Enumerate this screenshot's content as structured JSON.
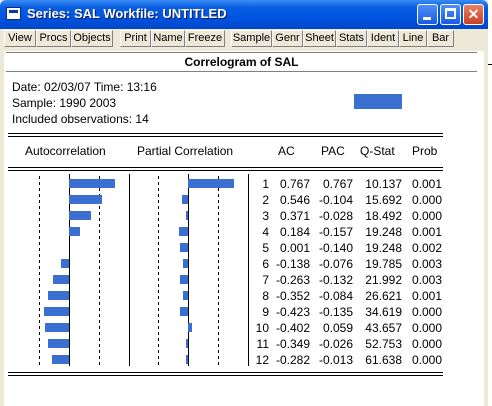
{
  "window": {
    "title": "Series: SAL    Workfile: UNTITLED",
    "controls": [
      "minimize-icon",
      "maximize-icon",
      "close-icon"
    ]
  },
  "toolbar": [
    "View",
    "Procs",
    "Objects",
    "Print",
    "Name",
    "Freeze",
    "Sample",
    "Genr",
    "Sheet",
    "Stats",
    "Ident",
    "Line",
    "Bar"
  ],
  "heading": "Correlogram of SAL",
  "info": {
    "date_line": "Date: 02/03/07   Time: 13:16",
    "sample_line": "Sample: 1990 2003",
    "obs_line": "Included observations: 14"
  },
  "columns": {
    "autocorrelation": "Autocorrelation",
    "partial_correlation": "Partial Correlation",
    "ac": "AC",
    "pac": "PAC",
    "qstat": "Q-Stat",
    "prob": "Prob"
  },
  "colors": {
    "bar": "#3b6fd0",
    "titlebar": "#0054e3"
  },
  "chart_data": {
    "type": "bar",
    "title": "Correlogram of SAL",
    "categories": [
      "1",
      "2",
      "3",
      "4",
      "5",
      "6",
      "7",
      "8",
      "9",
      "10",
      "11",
      "12"
    ],
    "series": [
      {
        "name": "AC",
        "values": [
          0.767,
          0.546,
          0.371,
          0.184,
          0.001,
          -0.138,
          -0.263,
          -0.352,
          -0.423,
          -0.402,
          -0.349,
          -0.282
        ]
      },
      {
        "name": "PAC",
        "values": [
          0.767,
          -0.104,
          -0.028,
          -0.157,
          -0.14,
          -0.076,
          -0.132,
          -0.084,
          -0.135,
          0.059,
          -0.026,
          -0.013
        ]
      }
    ],
    "table": [
      {
        "lag": "1",
        "ac": "0.767",
        "pac": "0.767",
        "q": "10.137",
        "prob": "0.001"
      },
      {
        "lag": "2",
        "ac": "0.546",
        "pac": "-0.104",
        "q": "15.692",
        "prob": "0.000"
      },
      {
        "lag": "3",
        "ac": "0.371",
        "pac": "-0.028",
        "q": "18.492",
        "prob": "0.000"
      },
      {
        "lag": "4",
        "ac": "0.184",
        "pac": "-0.157",
        "q": "19.248",
        "prob": "0.001"
      },
      {
        "lag": "5",
        "ac": "0.001",
        "pac": "-0.140",
        "q": "19.248",
        "prob": "0.002"
      },
      {
        "lag": "6",
        "ac": "-0.138",
        "pac": "-0.076",
        "q": "19.785",
        "prob": "0.003"
      },
      {
        "lag": "7",
        "ac": "-0.263",
        "pac": "-0.132",
        "q": "21.992",
        "prob": "0.003"
      },
      {
        "lag": "8",
        "ac": "-0.352",
        "pac": "-0.084",
        "q": "26.621",
        "prob": "0.001"
      },
      {
        "lag": "9",
        "ac": "-0.423",
        "pac": "-0.135",
        "q": "34.619",
        "prob": "0.000"
      },
      {
        "lag": "10",
        "ac": "-0.402",
        "pac": "0.059",
        "q": "43.657",
        "prob": "0.000"
      },
      {
        "lag": "11",
        "ac": "-0.349",
        "pac": "-0.026",
        "q": "52.753",
        "prob": "0.000"
      },
      {
        "lag": "12",
        "ac": "-0.282",
        "pac": "-0.013",
        "q": "61.638",
        "prob": "0.000"
      }
    ]
  }
}
